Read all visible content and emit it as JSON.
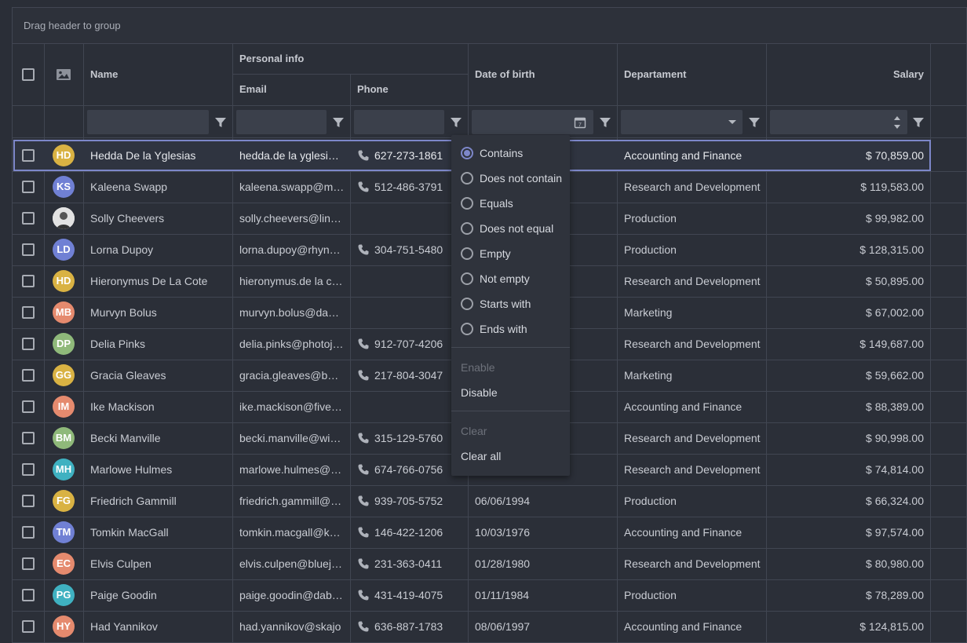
{
  "group_panel": {
    "label": "Drag header to group"
  },
  "columns": {
    "name": "Name",
    "personal_info": "Personal info",
    "email": "Email",
    "phone": "Phone",
    "date_of_birth": "Date of birth",
    "department": "Departament",
    "salary": "Salary"
  },
  "rows": [
    {
      "initials": "HD",
      "avatar_color": "#d9b243",
      "name": "Hedda De la Yglesias",
      "email": "hedda.de la yglesias@",
      "phone": "627-273-1861",
      "dob": "",
      "department": "Accounting and Finance",
      "salary": "$ 70,859.00"
    },
    {
      "initials": "KS",
      "avatar_color": "#7080d4",
      "name": "Kaleena Swapp",
      "email": "kaleena.swapp@mail.ru",
      "phone": "512-486-3791",
      "dob": "",
      "department": "Research and Development",
      "salary": "$ 119,583.00"
    },
    {
      "initials": "",
      "avatar_color": "#dcdcdc",
      "name": "Solly Cheevers",
      "email": "solly.cheevers@linkedin",
      "phone": "",
      "dob": "",
      "department": "Production",
      "salary": "$ 99,982.00"
    },
    {
      "initials": "LD",
      "avatar_color": "#7080d4",
      "name": "Lorna Dupoy",
      "email": "lorna.dupoy@rhynyx.com",
      "phone": "304-751-5480",
      "dob": "",
      "department": "Production",
      "salary": "$ 128,315.00"
    },
    {
      "initials": "HD",
      "avatar_color": "#d9b243",
      "name": "Hieronymus De La Cote",
      "email": "hieronymus.de la cote@",
      "phone": "",
      "dob": "",
      "department": "Research and Development",
      "salary": "$ 50,895.00"
    },
    {
      "initials": "MB",
      "avatar_color": "#e58a6e",
      "name": "Murvyn Bolus",
      "email": "murvyn.bolus@dabfeed",
      "phone": "",
      "dob": "",
      "department": "Marketing",
      "salary": "$ 67,002.00"
    },
    {
      "initials": "DP",
      "avatar_color": "#8fb97a",
      "name": "Delia Pinks",
      "email": "delia.pinks@photojam",
      "phone": "912-707-4206",
      "dob": "",
      "department": "Research and Development",
      "salary": "$ 149,687.00"
    },
    {
      "initials": "GG",
      "avatar_color": "#d9b243",
      "name": "Gracia Gleaves",
      "email": "gracia.gleaves@babbleset",
      "phone": "217-804-3047",
      "dob": "",
      "department": "Marketing",
      "salary": "$ 59,662.00"
    },
    {
      "initials": "IM",
      "avatar_color": "#e58a6e",
      "name": "Ike Mackison",
      "email": "ike.mackison@fivebridge",
      "phone": "",
      "dob": "",
      "department": "Accounting and Finance",
      "salary": "$ 88,389.00"
    },
    {
      "initials": "BM",
      "avatar_color": "#8fb97a",
      "name": "Becki Manville",
      "email": "becki.manville@wikivu",
      "phone": "315-129-5760",
      "dob": "",
      "department": "Research and Development",
      "salary": "$ 90,998.00"
    },
    {
      "initials": "MH",
      "avatar_color": "#3fb1c1",
      "name": "Marlowe Hulmes",
      "email": "marlowe.hulmes@oyondu",
      "phone": "674-766-0756",
      "dob": "",
      "department": "Research and Development",
      "salary": "$ 74,814.00"
    },
    {
      "initials": "FG",
      "avatar_color": "#d9b243",
      "name": "Friedrich Gammill",
      "email": "friedrich.gammill@eare",
      "phone": "939-705-5752",
      "dob": "06/06/1994",
      "department": "Production",
      "salary": "$ 66,324.00"
    },
    {
      "initials": "TM",
      "avatar_color": "#7080d4",
      "name": "Tomkin MacGall",
      "email": "tomkin.macgall@kayveo",
      "phone": "146-422-1206",
      "dob": "10/03/1976",
      "department": "Accounting and Finance",
      "salary": "$ 97,574.00"
    },
    {
      "initials": "EC",
      "avatar_color": "#e58a6e",
      "name": "Elvis Culpen",
      "email": "elvis.culpen@bluejam",
      "phone": "231-363-0411",
      "dob": "01/28/1980",
      "department": "Research and Development",
      "salary": "$ 80,980.00"
    },
    {
      "initials": "PG",
      "avatar_color": "#3fb1c1",
      "name": "Paige Goodin",
      "email": "paige.goodin@dabfeed",
      "phone": "431-419-4075",
      "dob": "01/11/1984",
      "department": "Production",
      "salary": "$ 78,289.00"
    },
    {
      "initials": "HY",
      "avatar_color": "#e58a6e",
      "name": "Had Yannikov",
      "email": "had.yannikov@skajo",
      "phone": "636-887-1783",
      "dob": "08/06/1997",
      "department": "Accounting and Finance",
      "salary": "$ 124,815.00"
    }
  ],
  "filter_menu": {
    "options": [
      "Contains",
      "Does not contain",
      "Equals",
      "Does not equal",
      "Empty",
      "Not empty",
      "Starts with",
      "Ends with"
    ],
    "selected": "Contains",
    "enable": "Enable",
    "disable": "Disable",
    "clear": "Clear",
    "clear_all": "Clear all"
  },
  "colors": {
    "accent": "#7d87c9",
    "background": "#2a2e37",
    "border": "#414652"
  }
}
